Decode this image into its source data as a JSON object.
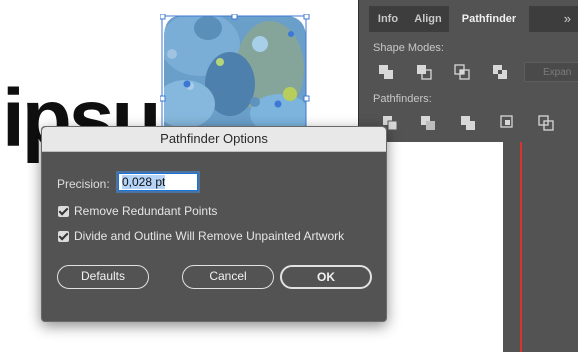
{
  "canvas": {
    "big_text": "ipsum"
  },
  "panel": {
    "tabs": [
      {
        "label": "Info"
      },
      {
        "label": "Align"
      },
      {
        "label": "Pathfinder"
      }
    ],
    "menu_icon": "»",
    "shape_modes_label": "Shape Modes:",
    "pathfinders_label": "Pathfinders:",
    "expand_label": "Expan"
  },
  "dialog": {
    "title": "Pathfinder Options",
    "precision_label": "Precision:",
    "precision_value": "0,028 pt",
    "remove_redundant_label": "Remove Redundant Points",
    "divide_outline_label": "Divide and Outline Will Remove Unpainted Artwork",
    "defaults_label": "Defaults",
    "cancel_label": "Cancel",
    "ok_label": "OK"
  },
  "colors": {
    "panel_bg": "#535353",
    "accent_blue": "#1a73d9",
    "guide_red": "#d9342b"
  }
}
